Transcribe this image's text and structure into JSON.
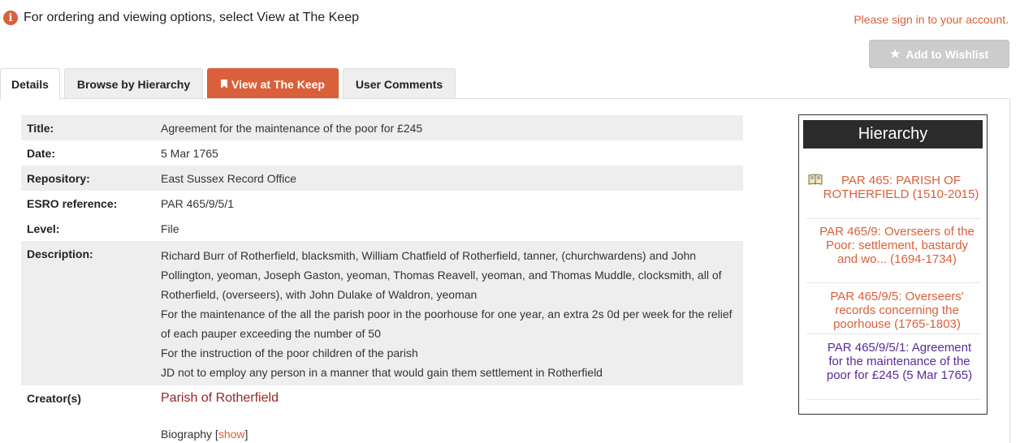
{
  "info": {
    "message": "For ordering and viewing options, select View at The Keep",
    "icon": "info-icon"
  },
  "account": {
    "signin_text": "Please sign in to your account."
  },
  "wishlist": {
    "label": "Add to Wishlist",
    "icon": "star-icon"
  },
  "tabs": [
    {
      "label": "Details"
    },
    {
      "label": "Browse by Hierarchy"
    },
    {
      "label": "View at The Keep"
    },
    {
      "label": "User Comments"
    }
  ],
  "record": {
    "title_label": "Title:",
    "title": "Agreement for the maintenance of the poor for £245",
    "date_label": "Date:",
    "date": "5 Mar 1765",
    "repository_label": "Repository:",
    "repository": "East Sussex Record Office",
    "reference_label": "ESRO reference:",
    "reference": "PAR 465/9/5/1",
    "level_label": "Level:",
    "level": "File",
    "description_label": "Description:",
    "description_lines": [
      "Richard Burr of Rotherfield, blacksmith, William Chatfield of Rotherfield, tanner, (churchwardens) and John Pollington, yeoman, Joseph Gaston, yeoman, Thomas Reavell, yeoman, and Thomas Muddle, clocksmith, all of Rotherfield, (overseers), with John Dulake of Waldron, yeoman",
      "For the maintenance of the all the parish poor in the poorhouse for one year, an extra 2s 0d per week for the relief of each pauper exceeding the number of 50",
      "For the instruction of the poor children of the parish",
      "JD not to employ any person in a manner that would gain them settlement in Rotherfield"
    ],
    "creators_label": "Creator(s)",
    "creator": "Parish of Rotherfield",
    "biography_label": "Biography",
    "biography_show": "show"
  },
  "hierarchy": {
    "heading": "Hierarchy",
    "items": [
      {
        "label": "PAR 465: PARISH OF ROTHERFIELD (1510-2015)"
      },
      {
        "label": "PAR 465/9: Overseers of the Poor: settlement, bastardy and wo... (1694-1734)"
      },
      {
        "label": "PAR 465/9/5: Overseers' records concerning the poorhouse (1765-1803)"
      },
      {
        "label": "PAR 465/9/5/1: Agreement for the maintenance of the poor for £245 (5 Mar 1765)"
      }
    ]
  },
  "colors": {
    "accent": "#d9603a",
    "current_item": "#5b2a9a",
    "creator_link": "#9a2424",
    "header_dark": "#2b2b2b",
    "row_shade": "#eeeeee"
  }
}
